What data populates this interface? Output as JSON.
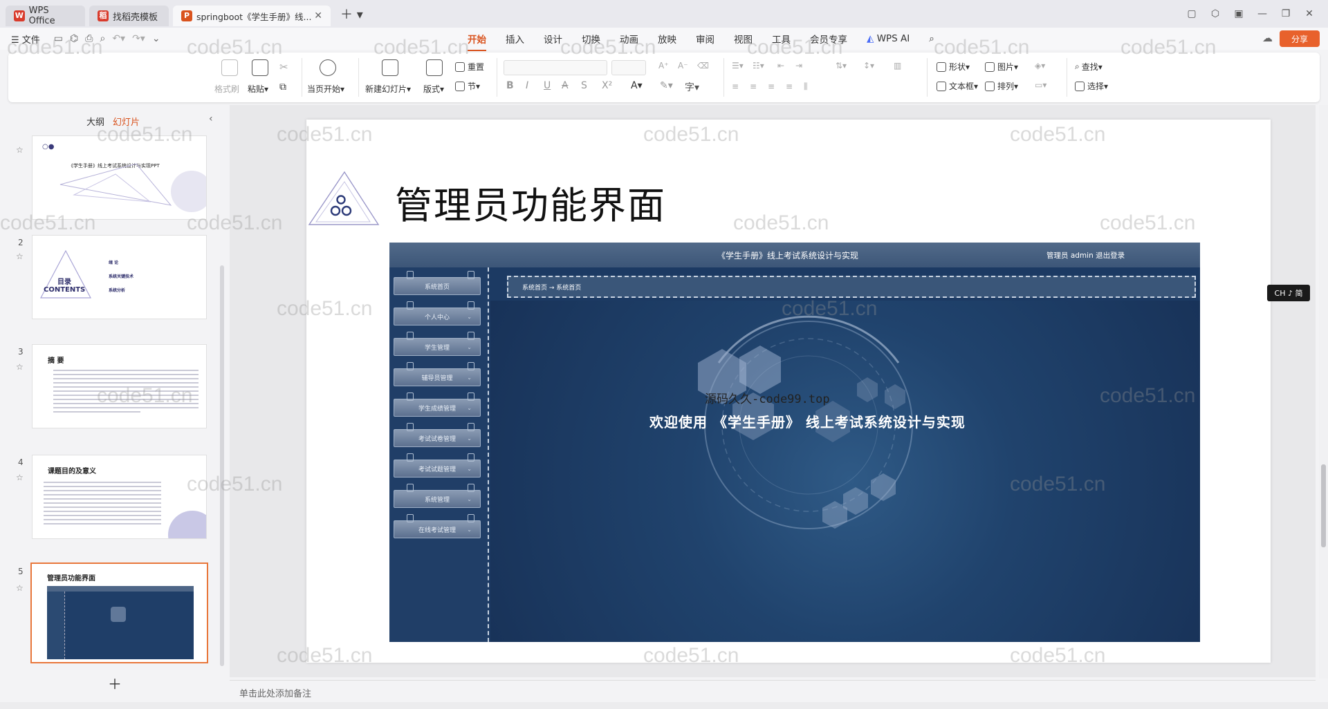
{
  "tabs": [
    {
      "label": "WPS Office",
      "logo": "W",
      "color": "#d93b2c"
    },
    {
      "label": "找稻壳模板",
      "logo": "稻",
      "color": "#d93b2c"
    },
    {
      "label": "springboot《学生手册》线...",
      "logo": "P",
      "color": "#d9531e"
    }
  ],
  "menubar": {
    "file": "☰ 文件",
    "tabs": [
      "开始",
      "插入",
      "设计",
      "切换",
      "动画",
      "放映",
      "审阅",
      "视图",
      "工具",
      "会员专享"
    ],
    "active_tab": "开始",
    "wps_ai": "WPS AI",
    "share": "分享"
  },
  "ribbon": {
    "format_painter": "格式刷",
    "paste": "粘贴",
    "start_from_current": "当页开始",
    "new_slide": "新建幻灯片",
    "layout": "版式",
    "reset": "重置",
    "section": "节",
    "shape": "形状",
    "picture": "图片",
    "textbox": "文本框",
    "arrange": "排列",
    "find": "查找",
    "select": "选择"
  },
  "leftpanel": {
    "outline_tab": "大纲",
    "slides_tab": "幻灯片",
    "slides": [
      {
        "num": "",
        "title": "《学生手册》线上考试系统设计与实现PPT"
      },
      {
        "num": "2",
        "title": "目录 CONTENTS",
        "items": [
          "绪 论",
          "系统关键技术",
          "系统分析"
        ]
      },
      {
        "num": "3",
        "title": "摘 要"
      },
      {
        "num": "4",
        "title": "课题目的及意义"
      },
      {
        "num": "5",
        "title": "管理员功能界面"
      }
    ]
  },
  "slide": {
    "title": "管理员功能界面",
    "admin": {
      "header": "《学生手册》线上考试系统设计与实现",
      "user": "管理员 admin  退出登录",
      "breadcrumb": "系统首页  →  系统首页",
      "menu": [
        "系统首页",
        "个人中心",
        "学生管理",
        "辅导员管理",
        "学生成绩管理",
        "考试试卷管理",
        "考试试题管理",
        "系统管理",
        "在线考试管理"
      ],
      "welcome": "欢迎使用 《学生手册》 线上考试系统设计与实现",
      "source_mark": "源码久久-code99.top"
    }
  },
  "notes_placeholder": "单击此处添加备注",
  "ime": "CH ♪ 简",
  "watermark": "code51.cn"
}
